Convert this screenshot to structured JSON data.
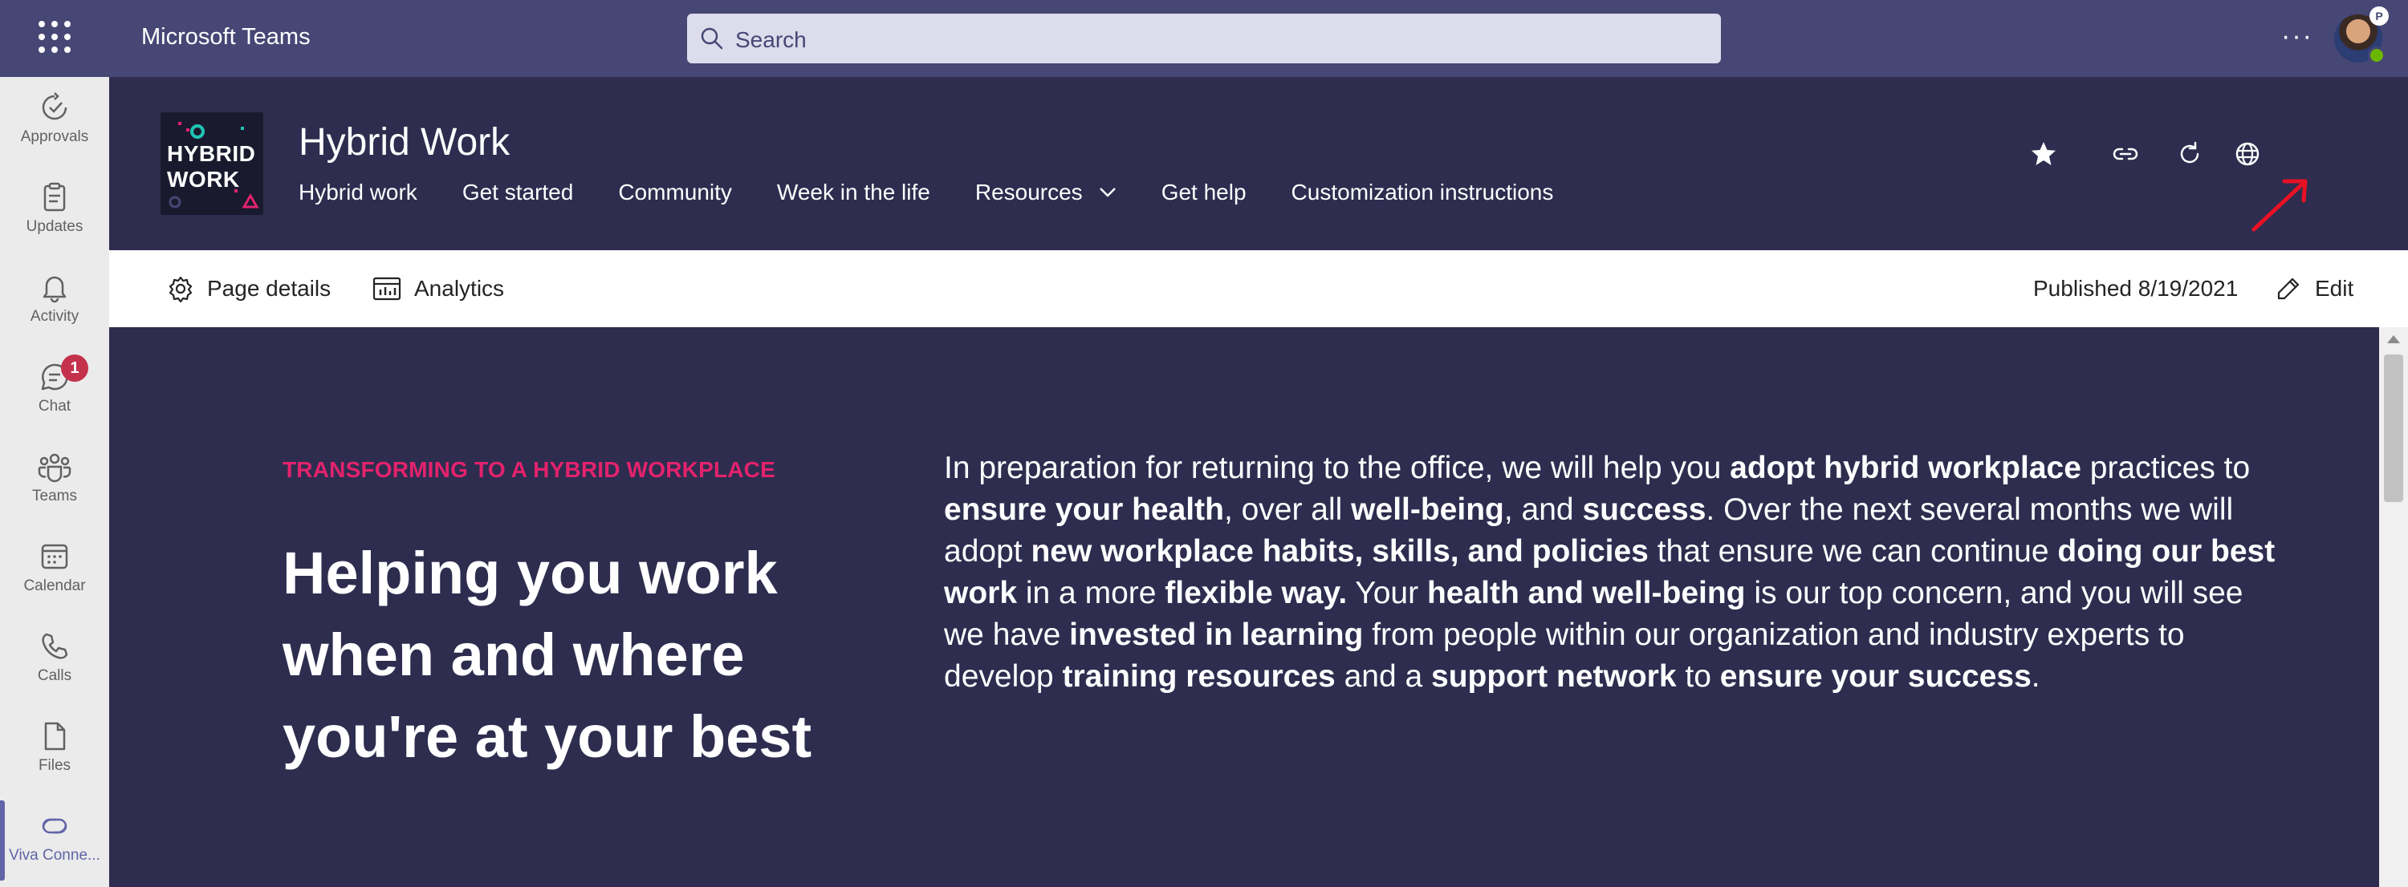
{
  "topbar": {
    "app_title": "Microsoft Teams",
    "search_placeholder": "Search",
    "more_label": "···",
    "avatar_badge": "P"
  },
  "rail": {
    "items": [
      {
        "label": "Approvals",
        "icon": "approvals-icon"
      },
      {
        "label": "Updates",
        "icon": "updates-icon"
      },
      {
        "label": "Activity",
        "icon": "bell-icon"
      },
      {
        "label": "Chat",
        "icon": "chat-icon",
        "badge": "1"
      },
      {
        "label": "Teams",
        "icon": "teams-icon"
      },
      {
        "label": "Calendar",
        "icon": "calendar-icon"
      },
      {
        "label": "Calls",
        "icon": "phone-icon"
      },
      {
        "label": "Files",
        "icon": "file-icon"
      },
      {
        "label": "Viva Conne...",
        "icon": "viva-connections-icon",
        "active": true
      }
    ]
  },
  "site": {
    "logo_text_line1": "HYBRID",
    "logo_text_line2": "WORK",
    "title": "Hybrid Work",
    "nav": [
      "Hybrid work",
      "Get started",
      "Community",
      "Week in the life",
      "Resources",
      "Get help",
      "Customization instructions"
    ],
    "icons": [
      "star-icon",
      "link-icon",
      "refresh-icon",
      "globe-icon",
      "save-for-later-icon"
    ]
  },
  "command_bar": {
    "page_details": "Page details",
    "analytics": "Analytics",
    "published": "Published 8/19/2021",
    "edit": "Edit"
  },
  "hero": {
    "eyebrow": "TRANSFORMING TO A HYBRID WORKPLACE",
    "heading": "Helping you work when and where you're at your best",
    "body": [
      {
        "t": "In preparation for returning to the office, we will help you ",
        "b": false
      },
      {
        "t": "adopt hybrid workplace",
        "b": true
      },
      {
        "t": " practices to ",
        "b": false
      },
      {
        "t": "ensure your health",
        "b": true
      },
      {
        "t": ", over all ",
        "b": false
      },
      {
        "t": "well-being",
        "b": true
      },
      {
        "t": ", and ",
        "b": false
      },
      {
        "t": "success",
        "b": true
      },
      {
        "t": ". Over the next several months we will adopt ",
        "b": false
      },
      {
        "t": "new workplace habits, skills, and policies",
        "b": true
      },
      {
        "t": " that ensure we can continue ",
        "b": false
      },
      {
        "t": "doing our best work",
        "b": true
      },
      {
        "t": " in a more ",
        "b": false
      },
      {
        "t": "flexible way.",
        "b": true
      },
      {
        "t": " Your ",
        "b": false
      },
      {
        "t": "health and well-being",
        "b": true
      },
      {
        "t": " is our top concern, and you will see we have ",
        "b": false
      },
      {
        "t": "invested in learning",
        "b": true
      },
      {
        "t": " from people within our organization and industry experts to develop ",
        "b": false
      },
      {
        "t": "training resources",
        "b": true
      },
      {
        "t": " and a ",
        "b": false
      },
      {
        "t": "support network",
        "b": true
      },
      {
        "t": " to ",
        "b": false
      },
      {
        "t": "ensure your success",
        "b": true
      },
      {
        "t": ".",
        "b": false
      }
    ]
  },
  "colors": {
    "teams_purple": "#464775",
    "site_navy": "#2e2d4f",
    "eyebrow_pink": "#e3226d",
    "annotation_red": "#e81123"
  }
}
